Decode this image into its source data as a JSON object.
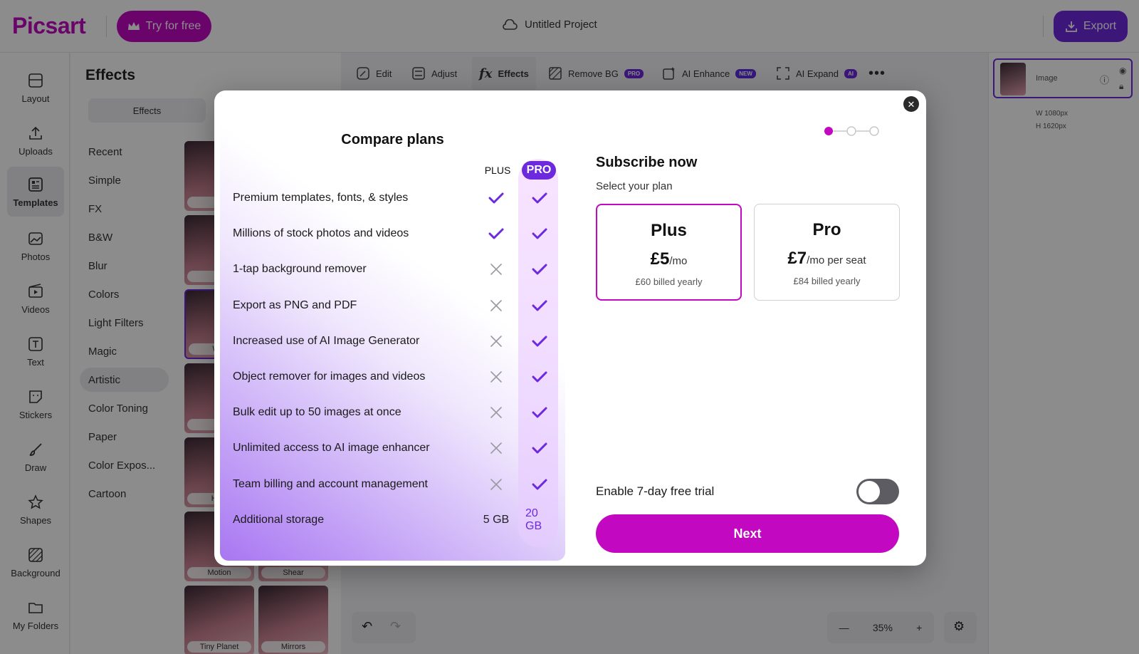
{
  "header": {
    "logo": "Picsart",
    "try_label": "Try for free",
    "project_title": "Untitled Project",
    "export_label": "Export"
  },
  "leftnav": {
    "items": [
      {
        "label": "Layout",
        "icon": "layout-icon"
      },
      {
        "label": "Uploads",
        "icon": "upload-icon"
      },
      {
        "label": "Templates",
        "icon": "templates-icon",
        "active": true
      },
      {
        "label": "Photos",
        "icon": "photos-icon"
      },
      {
        "label": "Videos",
        "icon": "videos-icon"
      },
      {
        "label": "Text",
        "icon": "text-icon"
      },
      {
        "label": "Stickers",
        "icon": "stickers-icon"
      },
      {
        "label": "Draw",
        "icon": "draw-icon"
      },
      {
        "label": "Shapes",
        "icon": "shapes-icon"
      },
      {
        "label": "Background",
        "icon": "background-icon"
      },
      {
        "label": "My Folders",
        "icon": "folder-icon"
      }
    ]
  },
  "effects_panel": {
    "title": "Effects",
    "tab": "Effects",
    "categories": [
      "Recent",
      "Simple",
      "FX",
      "B&W",
      "Blur",
      "Colors",
      "Light Filters",
      "Magic",
      "Artistic",
      "Color Toning",
      "Paper",
      "Color Expos...",
      "Cartoon"
    ],
    "active_category": "Artistic",
    "thumbs": [
      "N",
      "Fa",
      "Wat",
      "Po",
      "Halft",
      "Motion",
      "Shear",
      "Tiny Planet",
      "Mirrors"
    ]
  },
  "toolbar": {
    "edit": "Edit",
    "adjust": "Adjust",
    "effects": "Effects",
    "remove_bg": "Remove BG",
    "remove_bg_badge": "PRO",
    "ai_enhance": "AI Enhance",
    "ai_enhance_badge": "NEW",
    "ai_expand": "AI Expand",
    "ai_expand_badge": "AI"
  },
  "layers": {
    "image_label": "Image",
    "width": "W 1080px",
    "height": "H 1620px"
  },
  "zoom": {
    "value": "35%"
  },
  "modal": {
    "compare_title": "Compare plans",
    "col_plus": "PLUS",
    "col_pro": "PRO",
    "features": [
      {
        "label": "Premium templates, fonts, & styles",
        "plus": "check",
        "pro": "check"
      },
      {
        "label": "Millions of stock photos and videos",
        "plus": "check",
        "pro": "check"
      },
      {
        "label": "1-tap background remover",
        "plus": "cross",
        "pro": "check"
      },
      {
        "label": "Export as PNG and PDF",
        "plus": "cross",
        "pro": "check"
      },
      {
        "label": "Increased use of AI Image Generator",
        "plus": "cross",
        "pro": "check"
      },
      {
        "label": "Object remover for images and videos",
        "plus": "cross",
        "pro": "check"
      },
      {
        "label": "Bulk edit up to 50 images at once",
        "plus": "cross",
        "pro": "check"
      },
      {
        "label": "Unlimited access to AI image enhancer",
        "plus": "cross",
        "pro": "check"
      },
      {
        "label": "Team billing and account management",
        "plus": "cross",
        "pro": "check"
      },
      {
        "label": "Additional storage",
        "plus": "5 GB",
        "pro": "20 GB"
      }
    ],
    "subscribe_title": "Subscribe now",
    "select_label": "Select your plan",
    "plans": [
      {
        "name": "Plus",
        "price": "£5",
        "period": "/mo",
        "billed": "£60 billed yearly",
        "selected": true
      },
      {
        "name": "Pro",
        "price": "£7",
        "period": "/mo per seat",
        "billed": "£84 billed yearly",
        "selected": false
      }
    ],
    "trial_label": "Enable 7-day free trial",
    "trial_enabled": false,
    "next_label": "Next",
    "step": {
      "current": 1,
      "total": 3
    }
  },
  "colors": {
    "brand": "#c209c1",
    "accent": "#6d29dd"
  }
}
